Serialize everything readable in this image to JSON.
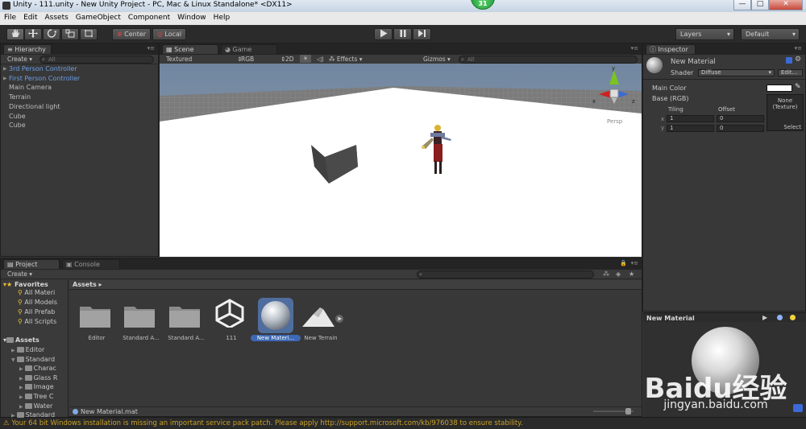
{
  "window": {
    "title": "Unity - 111.unity - New Unity Project - PC, Mac & Linux Standalone* <DX11>",
    "badge": "31",
    "minimize": "—",
    "maximize": "□",
    "close": "✕"
  },
  "menu": [
    "File",
    "Edit",
    "Assets",
    "GameObject",
    "Component",
    "Window",
    "Help"
  ],
  "toolbar": {
    "pivot": "Center",
    "space": "Local",
    "layers": "Layers",
    "layout": "Default"
  },
  "hierarchy": {
    "tab": "Hierarchy",
    "create": "Create",
    "search_placeholder": "All",
    "items": [
      {
        "label": "3rd Person Controller",
        "prefab": true
      },
      {
        "label": "First Person Controller",
        "prefab": true
      },
      {
        "label": "Main Camera",
        "prefab": false
      },
      {
        "label": "Terrain",
        "prefab": false
      },
      {
        "label": "Directional light",
        "prefab": false
      },
      {
        "label": "Cube",
        "prefab": false
      },
      {
        "label": "Cube",
        "prefab": false
      }
    ]
  },
  "scene": {
    "tab_scene": "Scene",
    "tab_game": "Game",
    "shading": "Textured",
    "render": "RGB",
    "mode_2d": "2D",
    "effects": "Effects",
    "gizmos": "Gizmos",
    "search_placeholder": "All",
    "gizmo_y": "y",
    "gizmo_x": "x",
    "gizmo_z": "z",
    "persp": "Persp"
  },
  "inspector": {
    "tab": "Inspector",
    "material_name": "New Material",
    "shader_label": "Shader",
    "shader_value": "Diffuse",
    "edit_btn": "Edit...",
    "main_color": "Main Color",
    "base_rgb": "Base (RGB)",
    "tiling": "Tiling",
    "offset": "Offset",
    "x": "x",
    "y": "y",
    "tiling_x": "1",
    "tiling_y": "1",
    "offset_x": "0",
    "offset_y": "0",
    "texture_none": "None",
    "texture_type": "(Texture)",
    "select": "Select"
  },
  "project": {
    "tab_project": "Project",
    "tab_console": "Console",
    "create": "Create",
    "favorites": "Favorites",
    "fav_items": [
      "All Materi",
      "All Models",
      "All Prefab",
      "All Scripts"
    ],
    "assets_root": "Assets",
    "tree": [
      "Editor",
      "Standard",
      "Charac",
      "Glass R",
      "Image",
      "Tree C",
      "Water",
      "Standard"
    ],
    "breadcrumb": "Assets",
    "assets": [
      {
        "name": "Editor",
        "type": "folder"
      },
      {
        "name": "Standard A...",
        "type": "folder"
      },
      {
        "name": "Standard A...",
        "type": "folder"
      },
      {
        "name": "111",
        "type": "unity"
      },
      {
        "name": "New Materi...",
        "type": "material"
      },
      {
        "name": "New Terrain",
        "type": "terrain"
      }
    ],
    "selected_path": "New Material.mat"
  },
  "preview": {
    "title": "New Material"
  },
  "watermark": {
    "brand": "Baidu经验",
    "url": "jingyan.baidu.com"
  },
  "status": {
    "message": "Your 64 bit Windows installation is missing an important service pack patch. Please apply http://support.microsoft.com/kb/976038 to ensure stability."
  },
  "colors": {
    "accent": "#3d68b5",
    "warning": "#c9a227",
    "prefab_blue": "#6d9ee6"
  }
}
